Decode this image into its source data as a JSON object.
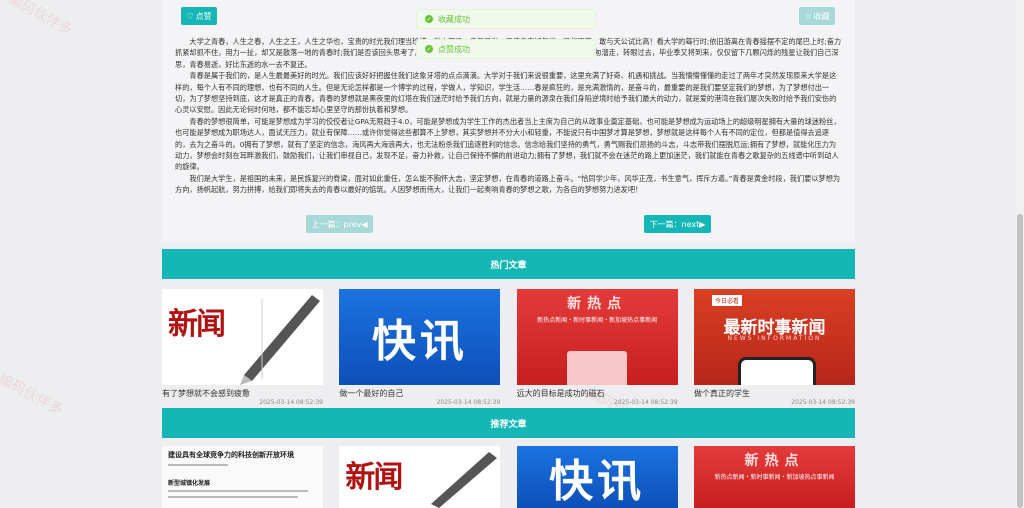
{
  "watermark": "编码伙伴多",
  "toolbar": {
    "like_label": "点赞",
    "favorite_label": "收藏"
  },
  "toasts": [
    "收藏成功",
    "点赞成功"
  ],
  "article": {
    "paragraphs": [
      "大学之青春，人生之春，人生之王，人生之华也，宝贵的时光我们理当珍惜，鲜衣怒马，意气风发，正值青春好年华，风华正茂，敢与天公试比高！看大学的蓦行时;依旧游离在青春摇摆不定的尾巴上时;奋力抓紧却抓不住，用力一扯，却又是散落一地的青春时;我们是否该回头思考了。零零碎碎的记忆，零零散散的情怀，来不及抓住，却匆匆溜走，转眼过去，毕业季又将到来，仅仅留下几颗闪烁的残星让我们自己深思，青春易逝，好比东逝的水一去不复还。",
      "青春是属于我们的，是人生最最美好的时光。我们应该好好把握住我们这象牙塔的点点滴滴。大学对于我们来说很重要，这里充满了好奇、机遇和挑战。当我懵懵懂懂的走过了两年才突然发现原来大学是这样的，每个人有不同的理想，也有不同的人生。但是无论怎样都是一个博学的过程，学做人，学知识，学生活……春是疯狂的，是充满激情的，是奋斗的，最重要的是我们要坚定我们的梦想，为了梦想付出一切，为了梦想坚持到底，这才是真正的青春。青春的梦想就是黑夜里的灯塔在我们迷茫时给予我们方向，就是力量的源泉在我们身陷逆境时给予我们最大的动力，就是爱的港湾在我们屡次失败时给予我们安伤的心灵以安慰。因此无论何时何地，都不能忘却心里坚守的那份执着和梦想。",
      "青春的梦想很简单，可能是梦想成为学习的佼佼者让GPA无限趋于4.0，可能是梦想成为学生工作的杰出者当上主席为自己的从政事业奠定基础，也可能是梦想成为运动场上的超级明星拥有大量的球迷粉丝，也可能是梦想成为职场达人，面试无压力，就业有保障……或许你觉得这些都算不上梦想，其实梦想并不分大小和轻重，不能说只有中国梦才算是梦想，梦想就是这样每个人有不同的定位，但都是值得去追逐的，去为之奋斗的。0拥有了梦想，就有了坚定的信念，海风再大海浪再大，也无法粉杀我们追逐胜利的信念。信念给我们坚持的勇气，勇气赐我们昂扬的斗志，斗志带我们摆脱厄运;拥有了梦想，就能化压力为动力，梦想会时刻在耳畔激我们，鼓励我们，让我们审视自己，发现不足，奋力补救，让自己保持不懈的前进动力;拥有了梦想，我们就不会在迷茫的路上更加迷茫，我们就能在青春之歌复杂的五线谱中听到动人的旋律。",
      "我们是大学生，是祖国的未来，是民族复兴的脊梁，面对如此重任，怎么能不胸怀大志，坚定梦想，在青春的道路上奋斗。“恰同学少年，风华正茂，书生意气，挥斥方遒。”青春是黄金时段，我们要以梦想为方向，扬帆起航，努力拼搏，给我们即将失去的青春以最好的惦筑。人因梦想而伟大，让我们一起奏响青春的梦想之歌，为各自的梦想努力进发吧！"
    ],
    "prev_label": "上一篇：prev◀",
    "next_label": "下一篇：next▶"
  },
  "hot": {
    "title": "热门文章",
    "cards": [
      {
        "title": "有了梦想就不会感到疲惫",
        "date": "2025-03-14 08:52:39",
        "thumb": "新闻"
      },
      {
        "title": "做一个最好的自己",
        "date": "2025-03-14 08:52:39",
        "thumb": "快讯"
      },
      {
        "title": "远大的目标是成功的磁石",
        "date": "2025-03-14 08:52:39",
        "thumb": "新热点"
      },
      {
        "title": "做个真正的学生",
        "date": "2025-03-14 08:52:39",
        "thumb": "最新时事新闻"
      }
    ]
  },
  "recommend": {
    "title": "推荐文章",
    "cards": [
      {
        "thumb": "建设具有全球竞争力的科技创新开放环境"
      },
      {
        "thumb": "新闻"
      },
      {
        "thumb": "快讯"
      },
      {
        "thumb": "新热点"
      }
    ]
  },
  "thumbs": {
    "red_sub": "新热点新闻・新时事新闻・新加坡热点事新闻",
    "dark_tag": "今日必看",
    "dark_en": "NEWS INFORMATION",
    "doc_sub": "新型城镇化发展"
  }
}
